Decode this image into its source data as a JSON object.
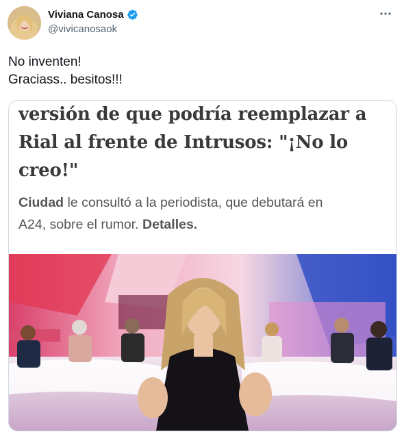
{
  "tweet": {
    "display_name": "Viviana Canosa",
    "handle": "@vivicanosaok",
    "text_lines": [
      "No inventen!",
      "Graciass.. besitos!!!"
    ]
  },
  "card": {
    "headline_lines": [
      "versión de que podría reemplazar a",
      "Rial al frente de Intrusos: \"¡No lo",
      "creo!\""
    ],
    "subtitle_lead": "Ciudad",
    "subtitle_line1_rest": " le consultó a la periodista, que debutará en",
    "subtitle_line2": "A24, sobre el rumor. ",
    "subtitle_link": "Detalles."
  },
  "icons": {
    "verified": "verified-badge-icon",
    "more": "more-options-icon"
  },
  "colors": {
    "verified_blue": "#1d9bf0",
    "handle_gray": "#536471",
    "card_border": "#cfd9de"
  }
}
